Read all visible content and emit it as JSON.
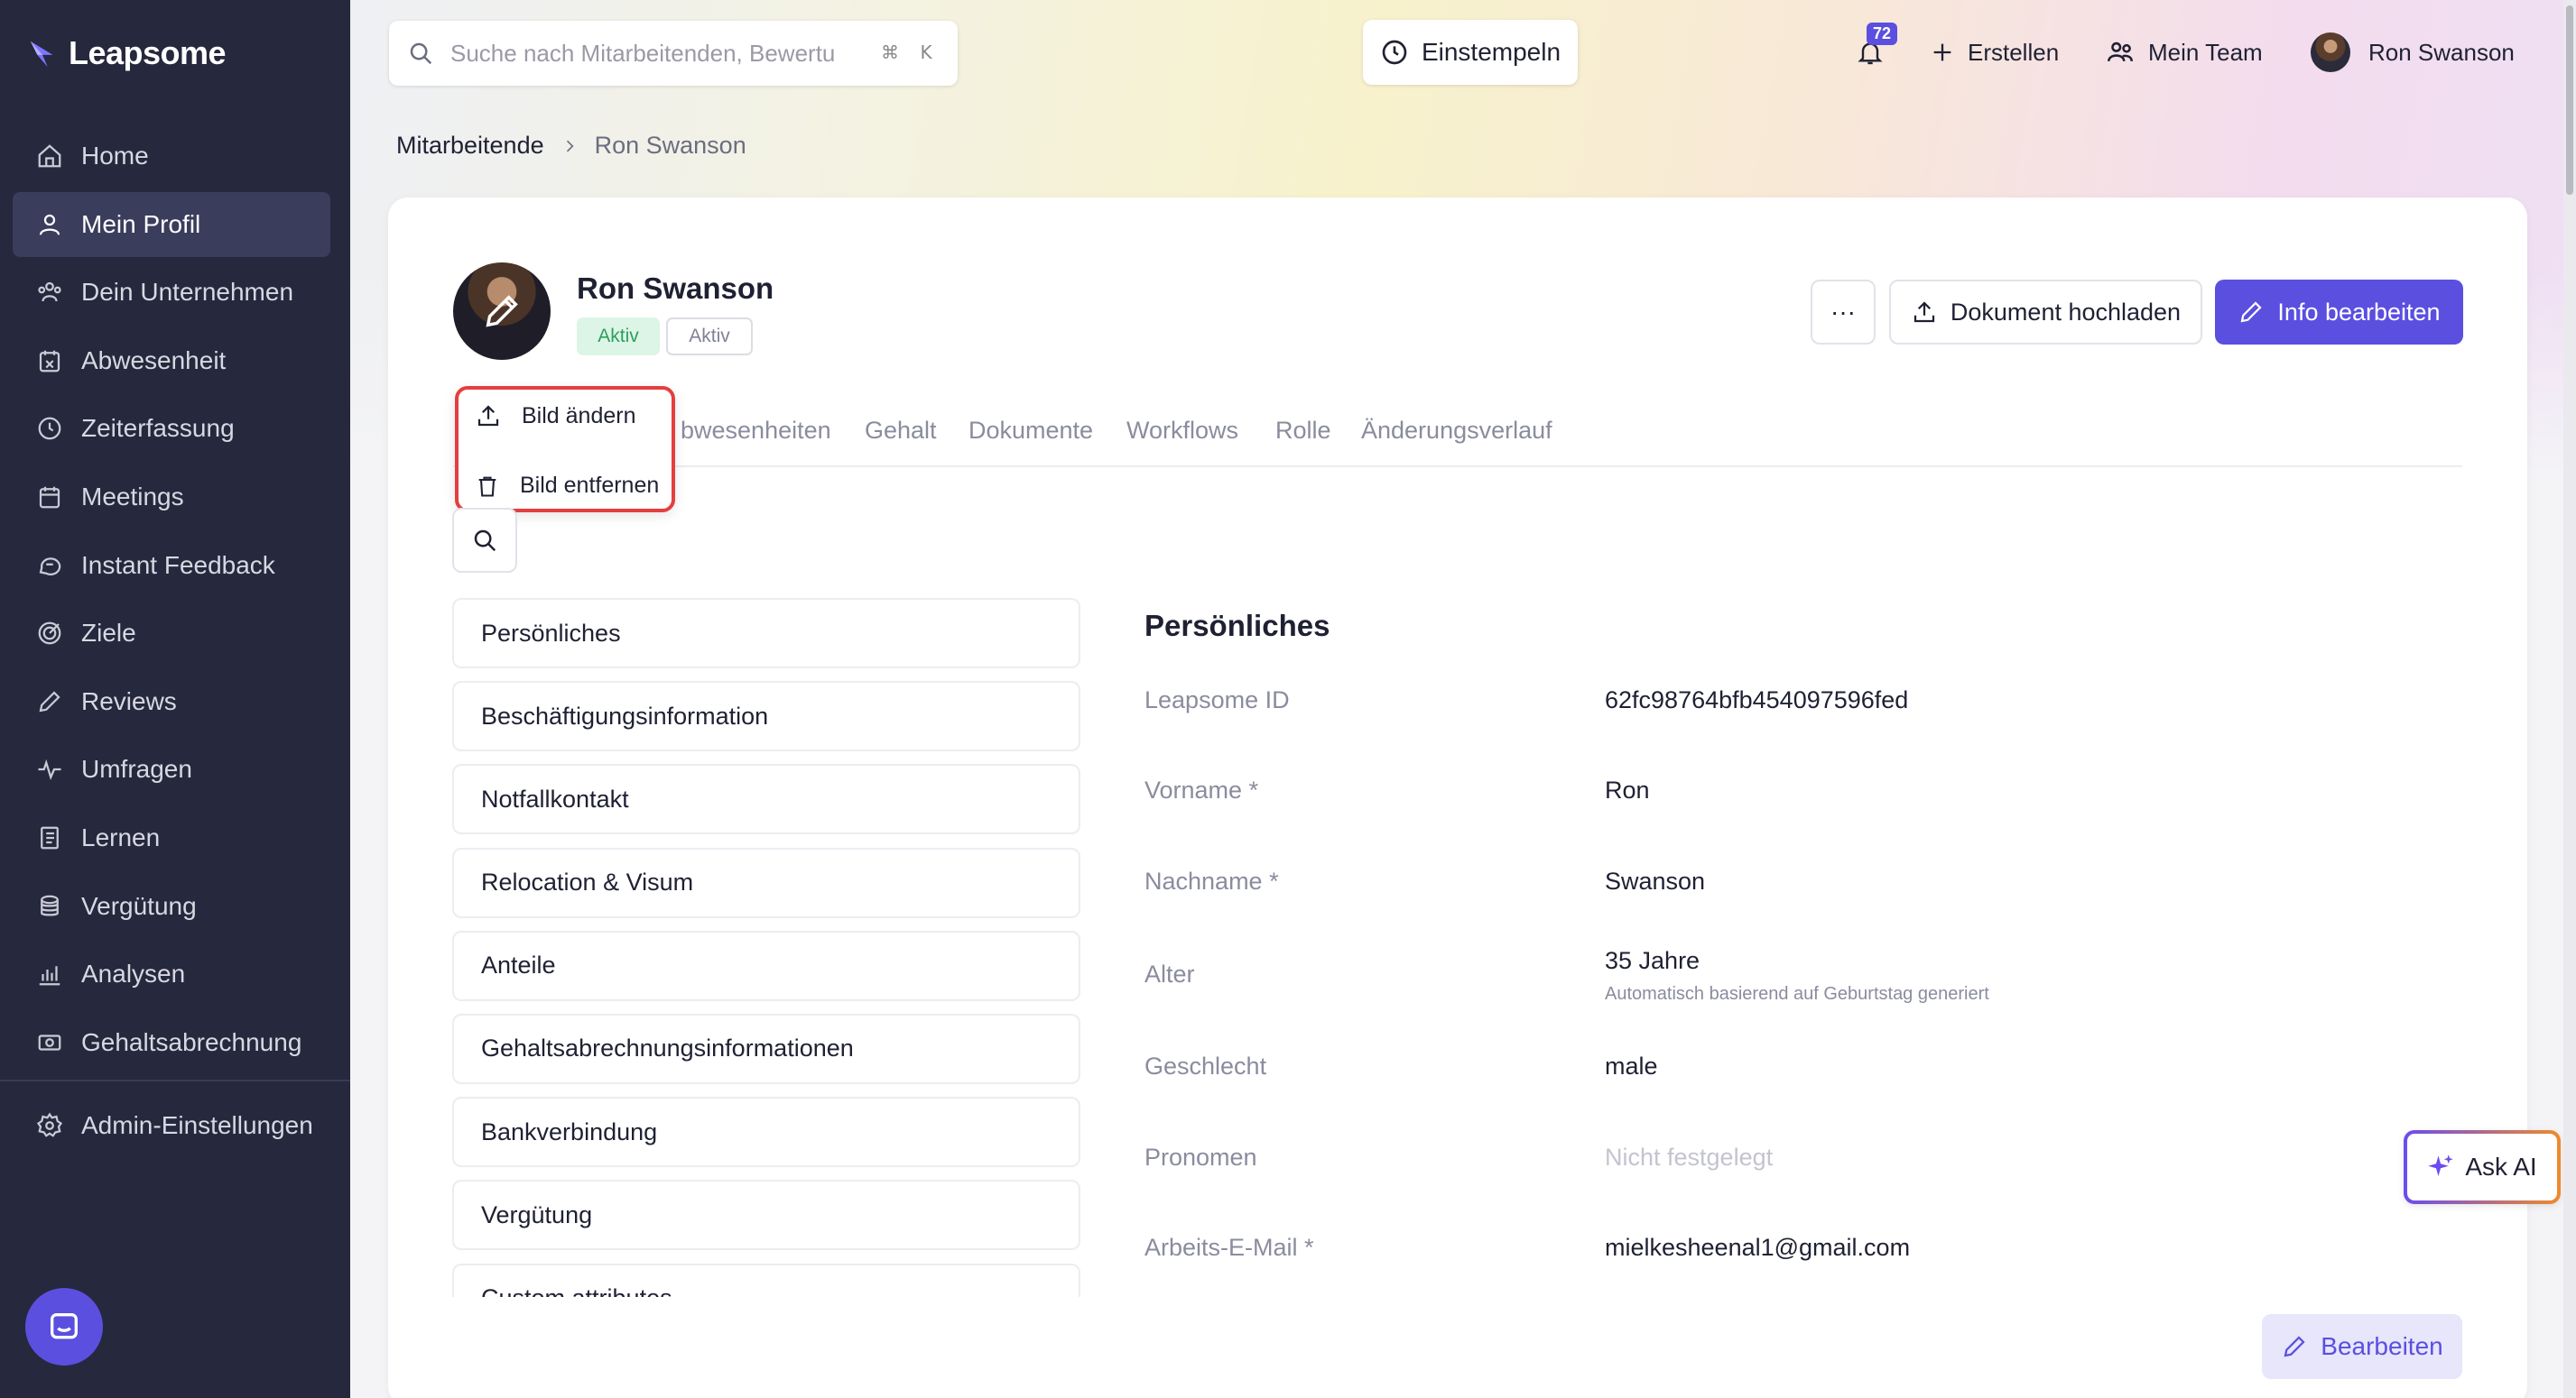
{
  "app": {
    "name": "Leapsome"
  },
  "sidebar": {
    "items": [
      {
        "label": "Home",
        "icon": "home-icon"
      },
      {
        "label": "Mein Profil",
        "icon": "user-icon",
        "active": true
      },
      {
        "label": "Dein Unternehmen",
        "icon": "people-icon"
      },
      {
        "label": "Abwesenheit",
        "icon": "calendar-x-icon"
      },
      {
        "label": "Zeiterfassung",
        "icon": "clock-icon"
      },
      {
        "label": "Meetings",
        "icon": "calendar-icon"
      },
      {
        "label": "Instant Feedback",
        "icon": "chat-icon"
      },
      {
        "label": "Ziele",
        "icon": "target-icon"
      },
      {
        "label": "Reviews",
        "icon": "pencil-icon"
      },
      {
        "label": "Umfragen",
        "icon": "pulse-icon"
      },
      {
        "label": "Lernen",
        "icon": "book-icon"
      },
      {
        "label": "Vergütung",
        "icon": "coins-icon"
      },
      {
        "label": "Analysen",
        "icon": "chart-icon"
      },
      {
        "label": "Gehaltsabrechnung",
        "icon": "cash-icon"
      }
    ],
    "admin": {
      "label": "Admin-Einstellungen",
      "icon": "gear-icon"
    }
  },
  "topbar": {
    "search_placeholder": "Suche nach Mitarbeitenden, Bewertu",
    "shortcut_cmd": "⌘",
    "shortcut_key": "K",
    "clock_in": "Einstempeln",
    "notifications_count": "72",
    "create": "Erstellen",
    "my_team": "Mein Team",
    "user_name": "Ron Swanson"
  },
  "breadcrumb": {
    "parent": "Mitarbeitende",
    "current": "Ron Swanson"
  },
  "profile": {
    "name": "Ron Swanson",
    "status_badge": "Aktiv",
    "status_badge_2": "Aktiv",
    "more": "···",
    "upload_document": "Dokument hochladen",
    "edit_info": "Info bearbeiten"
  },
  "tabs": [
    "bwesenheiten",
    "Gehalt",
    "Dokumente",
    "Workflows",
    "Rolle",
    "Änderungsverlauf"
  ],
  "avatar_menu": {
    "change": "Bild ändern",
    "remove": "Bild entfernen"
  },
  "sections": [
    "Persönliches",
    "Beschäftigungsinformation",
    "Notfallkontakt",
    "Relocation & Visum",
    "Anteile",
    "Gehaltsabrechnungsinformationen",
    "Bankverbindung",
    "Vergütung",
    "Custom attributes"
  ],
  "details": {
    "title": "Persönliches",
    "rows": [
      {
        "label": "Leapsome ID",
        "value": "62fc98764bfb454097596fed"
      },
      {
        "label": "Vorname *",
        "value": "Ron"
      },
      {
        "label": "Nachname *",
        "value": "Swanson"
      },
      {
        "label": "Alter",
        "value": "35 Jahre",
        "sub": "Automatisch basierend auf Geburtstag generiert"
      },
      {
        "label": "Geschlecht",
        "value": "male"
      },
      {
        "label": "Pronomen",
        "value": "Nicht festgelegt"
      },
      {
        "label": "Arbeits-E-Mail *",
        "value": "mielkesheenal1@gmail.com"
      }
    ]
  },
  "ask_ai": "Ask AI",
  "edit_button": "Bearbeiten",
  "colors": {
    "sidebar": "#26283d",
    "accent": "#5b4fe0",
    "highlight": "#e53e3e"
  }
}
